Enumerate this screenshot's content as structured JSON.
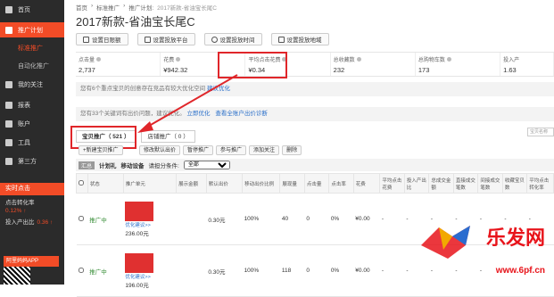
{
  "sidebar": {
    "items": [
      {
        "label": "首页",
        "active": false,
        "icon": "home-icon"
      },
      {
        "label": "推广计划",
        "active": true,
        "icon": "plan-icon"
      }
    ],
    "subitems": [
      {
        "label": "标准推广",
        "current": true
      },
      {
        "label": "自动化推广",
        "current": false
      }
    ],
    "items2": [
      {
        "label": "我的关注",
        "icon": "heart-icon"
      },
      {
        "label": "报表",
        "icon": "report-icon"
      },
      {
        "label": "账户",
        "icon": "account-icon"
      },
      {
        "label": "工具",
        "icon": "tool-icon"
      },
      {
        "label": "第三方",
        "icon": "third-party-icon"
      }
    ],
    "realtime_title": "实时点击",
    "ctr_label": "点击转化率",
    "ctr_value": "0.12% ↑",
    "roi_label": "投入产出比",
    "roi_value": "0.36 ↑",
    "app_label": "阿里妈妈APP"
  },
  "breadcrumb": [
    "首页",
    "标准推广",
    "推广计划:",
    "2017新款-省油宝长尾C"
  ],
  "page_title": "2017新款-省油宝长尾C",
  "toolbar": [
    "设置日限额",
    "设置投放平台",
    "设置投放时间",
    "设置投放地域"
  ],
  "stats": [
    {
      "label": "点击量",
      "value": "2,737"
    },
    {
      "label": "花费",
      "value": "¥942.32"
    },
    {
      "label": "平均点击花费",
      "value": "¥0.34"
    },
    {
      "label": "总收藏数",
      "value": "232"
    },
    {
      "label": "总购物车数",
      "value": "173"
    },
    {
      "label": "投入产",
      "value": "1.63"
    }
  ],
  "notice1": {
    "text": "您有6个重点宝贝的创意存在竞品有较大优化空间",
    "link": "建议优化"
  },
  "notice2": {
    "text": "您有33个关键词有出价问题，建议优化。",
    "link": "立即优化",
    "link2": "查看全账户出价诊断"
  },
  "tabs": [
    {
      "label": "宝贝推广（ 521 ）",
      "on": true
    },
    {
      "label": "店铺推广（ 0 ）",
      "on": false
    }
  ],
  "search_placeholder": "宝贝名称",
  "actions": [
    "+新建宝贝推广",
    "修改默认出价",
    "暂停推广",
    "参与推广",
    "添加关注",
    "删除"
  ],
  "filter": {
    "tag": "汇总",
    "plan_label": "计划礼",
    "mobile_label": "移动设备",
    "cond_label": "请担分条件:",
    "cond_value": "全部"
  },
  "table": {
    "headers": [
      "",
      "状态",
      "推广单元",
      "展示金额",
      "默认出价",
      "移动出价比例",
      "展现量",
      "点击量",
      "点击率",
      "花费",
      "平均点击花费",
      "投入产出比",
      "总成交金额",
      "直接成交笔数",
      "间接成交笔数",
      "收藏宝贝数",
      "平均点击转化率"
    ],
    "rows": [
      {
        "status": "推广中",
        "unit_link": "优化建议>>",
        "price": "236.00元",
        "bid": "0.30元",
        "ratio": "100%",
        "impr": "40",
        "clicks": "0",
        "ctr": "0%",
        "cost": "¥0.00",
        "cpc": "-",
        "roi": "-",
        "gmv": "-",
        "direct": "-",
        "indirect": "-",
        "fav": "-",
        "cvr": "-"
      },
      {
        "status": "推广中",
        "unit_link": "优化建议>>",
        "price": "196.00元",
        "bid": "0.30元",
        "ratio": "100%",
        "impr": "118",
        "clicks": "0",
        "ctr": "0%",
        "cost": "¥0.00",
        "cpc": "-",
        "roi": "-",
        "gmv": "-",
        "direct": "-",
        "indirect": "-",
        "fav": "-",
        "cvr": "-"
      }
    ]
  },
  "watermark": {
    "text": "乐发网",
    "url": "www.6pf.cn"
  }
}
